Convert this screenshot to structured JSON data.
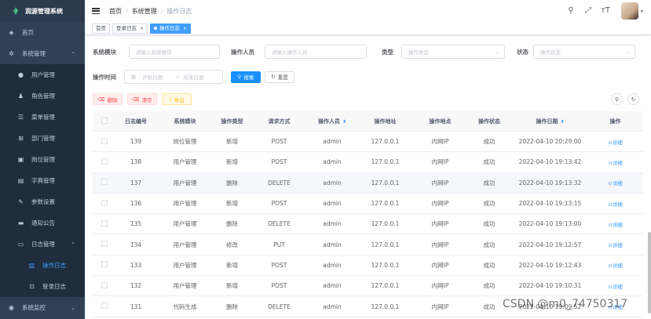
{
  "app": {
    "title": "润源管理系统"
  },
  "sidebar": {
    "items": [
      {
        "label": "首页",
        "icon": "dashboard-icon",
        "glyph": "◈"
      },
      {
        "label": "系统管理",
        "icon": "gear-icon",
        "glyph": "✲",
        "arrow": "⌃"
      },
      {
        "label": "用户管理",
        "icon": "user-icon",
        "glyph": "●",
        "sub": true
      },
      {
        "label": "角色管理",
        "icon": "peoples-icon",
        "glyph": "♟",
        "sub": true
      },
      {
        "label": "菜单管理",
        "icon": "tree-table-icon",
        "glyph": "☰",
        "sub": true
      },
      {
        "label": "部门管理",
        "icon": "tree-icon",
        "glyph": "⊞",
        "sub": true
      },
      {
        "label": "岗位管理",
        "icon": "post-icon",
        "glyph": "▣",
        "sub": true
      },
      {
        "label": "字典管理",
        "icon": "dict-icon",
        "glyph": "▤",
        "sub": true
      },
      {
        "label": "参数设置",
        "icon": "edit-icon",
        "glyph": "✎",
        "sub": true
      },
      {
        "label": "通知公告",
        "icon": "message-icon",
        "glyph": "▬",
        "sub": true
      },
      {
        "label": "日志管理",
        "icon": "log-icon",
        "glyph": "▭",
        "sub": true,
        "arrow": "⌃"
      },
      {
        "label": "操作日志",
        "icon": "form-icon",
        "glyph": "▥",
        "sub": true,
        "active": true,
        "deep": true
      },
      {
        "label": "登录日志",
        "icon": "logininfor-icon",
        "glyph": "⊡",
        "sub": true,
        "deep": true
      },
      {
        "label": "系统监控",
        "icon": "monitor-icon",
        "glyph": "◉",
        "arrow": "⌄"
      }
    ]
  },
  "navbar": {
    "breadcrumb": [
      "首页",
      "系统管理",
      "操作日志"
    ],
    "sep": "/",
    "icons": [
      {
        "name": "search-icon",
        "glyph": "⚲"
      },
      {
        "name": "fullscreen-icon",
        "glyph": "⤢"
      },
      {
        "name": "size-icon",
        "glyph": "тT"
      }
    ],
    "caret": "▾"
  },
  "tags": [
    {
      "label": "首页"
    },
    {
      "label": "登录日志",
      "close": "×"
    },
    {
      "label": "操作日志",
      "close": "×",
      "active": true
    }
  ],
  "search": {
    "module_label": "系统模块",
    "module_placeholder": "请输入系统模块",
    "operator_label": "操作人员",
    "operator_placeholder": "请输入操作人员",
    "type_label": "类型",
    "type_placeholder": "操作类型",
    "status_label": "状态",
    "status_placeholder": "操作状态",
    "time_label": "操作时间",
    "start_placeholder": "开始日期",
    "range_sep": "-",
    "end_placeholder": "结束日期",
    "search_btn": "搜索",
    "reset_btn": "重置"
  },
  "toolbar": {
    "delete_btn": "删除",
    "clean_btn": "清空",
    "export_btn": "导出"
  },
  "table": {
    "headers": [
      "日志编号",
      "系统模块",
      "操作类型",
      "请求方式",
      "操作人员",
      "操作地址",
      "操作地点",
      "操作状态",
      "操作日期",
      "操作"
    ],
    "detail_label": "详细",
    "rows": [
      [
        "139",
        "岗位管理",
        "新增",
        "POST",
        "admin",
        "127.0.0.1",
        "内网IP",
        "成功",
        "2022-04-10 20:29:00"
      ],
      [
        "138",
        "用户管理",
        "新增",
        "POST",
        "admin",
        "127.0.0.1",
        "内网IP",
        "成功",
        "2022-04-10 19:13:42"
      ],
      [
        "137",
        "用户管理",
        "删除",
        "DELETE",
        "admin",
        "127.0.0.1",
        "内网IP",
        "成功",
        "2022-04-10 19:13:32"
      ],
      [
        "136",
        "用户管理",
        "新增",
        "POST",
        "admin",
        "127.0.0.1",
        "内网IP",
        "成功",
        "2022-04-10 19:13:15"
      ],
      [
        "135",
        "用户管理",
        "删除",
        "DELETE",
        "admin",
        "127.0.0.1",
        "内网IP",
        "成功",
        "2022-04-10 19:13:00"
      ],
      [
        "134",
        "用户管理",
        "修改",
        "PUT",
        "admin",
        "127.0.0.1",
        "内网IP",
        "成功",
        "2022-04-10 19:12:57"
      ],
      [
        "133",
        "用户管理",
        "新增",
        "POST",
        "admin",
        "127.0.0.1",
        "内网IP",
        "成功",
        "2022-04-10 19:12:43"
      ],
      [
        "132",
        "用户管理",
        "新增",
        "POST",
        "admin",
        "127.0.0.1",
        "内网IP",
        "成功",
        "2022-04-10 19:10:31"
      ],
      [
        "131",
        "代码生成",
        "删除",
        "DELETE",
        "admin",
        "127.0.0.1",
        "内网IP",
        "成功",
        "2022-04-10 19:09:52"
      ]
    ]
  },
  "watermark": "CSDN @m0_74750317",
  "colors": {
    "sidebar": "#304156",
    "primary": "#409eff",
    "danger": "#ff4949",
    "warning": "#ffba00"
  }
}
